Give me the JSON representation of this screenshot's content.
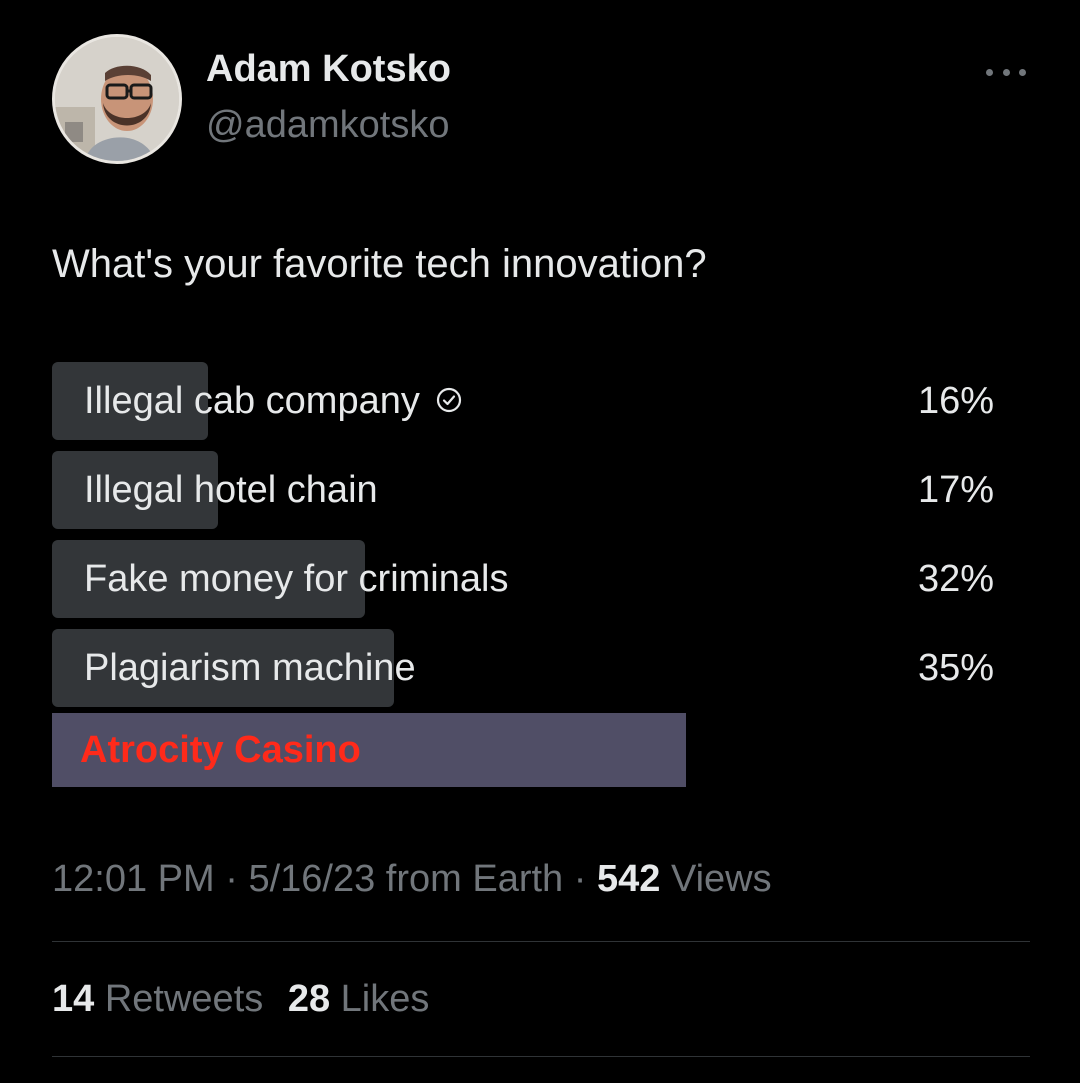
{
  "author": {
    "display_name": "Adam Kotsko",
    "handle": "@adamkotsko"
  },
  "tweet": {
    "text": "What's your favorite tech innovation?"
  },
  "poll": {
    "options": [
      {
        "label": "Illegal cab company",
        "percent_text": "16%",
        "percent": 16,
        "selected": true
      },
      {
        "label": "Illegal hotel chain",
        "percent_text": "17%",
        "percent": 17,
        "selected": false
      },
      {
        "label": "Fake money for criminals",
        "percent_text": "32%",
        "percent": 32,
        "selected": false
      },
      {
        "label": "Plagiarism machine",
        "percent_text": "35%",
        "percent": 35,
        "selected": false
      }
    ],
    "extra_option": {
      "label": "Atrocity Casino"
    }
  },
  "meta": {
    "time": "12:01 PM",
    "date": "5/16/23",
    "source": "from Earth",
    "separator": "·",
    "views_count": "542",
    "views_label": "Views"
  },
  "stats": {
    "retweets_count": "14",
    "retweets_label": "Retweets",
    "likes_count": "28",
    "likes_label": "Likes"
  },
  "colors": {
    "background": "#000000",
    "primary_text": "#e7e9ea",
    "secondary_text": "#71767b",
    "poll_bar": "#333639",
    "extra_option_bg": "#504e66",
    "extra_option_text": "#ff2a1a"
  },
  "icons": {
    "more": "more-horizontal-icon",
    "selected": "check-circle-icon"
  }
}
